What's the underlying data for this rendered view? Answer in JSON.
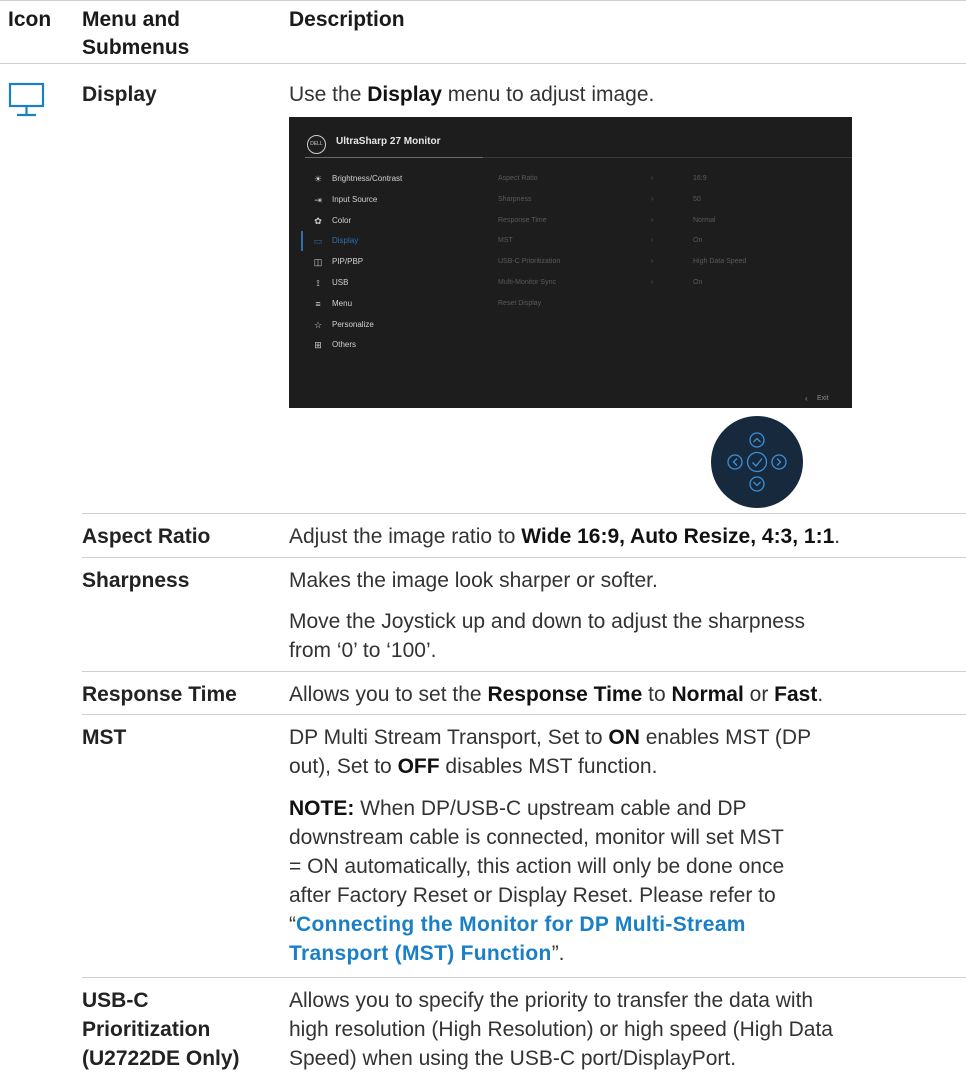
{
  "header": {
    "icon": "Icon",
    "menu": "Menu and Submenus",
    "description": "Description"
  },
  "display_row": {
    "icon": "monitor-icon",
    "label": "Display",
    "desc_pre": "Use the ",
    "desc_bold": "Display",
    "desc_post": " menu to adjust image."
  },
  "osd": {
    "logo": "DELL",
    "title": "UltraSharp 27 Monitor",
    "nav": [
      {
        "icon": "brightness-icon",
        "glyph": "☀",
        "label": "Brightness/Contrast"
      },
      {
        "icon": "input-source-icon",
        "glyph": "⇥",
        "label": "Input Source"
      },
      {
        "icon": "color-icon",
        "glyph": "✿",
        "label": "Color"
      },
      {
        "icon": "display-icon",
        "glyph": "▭",
        "label": "Display",
        "active": true
      },
      {
        "icon": "pip-pbp-icon",
        "glyph": "◫",
        "label": "PIP/PBP"
      },
      {
        "icon": "usb-icon",
        "glyph": "⟟",
        "label": "USB"
      },
      {
        "icon": "menu-icon",
        "glyph": "≡",
        "label": "Menu"
      },
      {
        "icon": "star-icon",
        "glyph": "☆",
        "label": "Personalize"
      },
      {
        "icon": "others-icon",
        "glyph": "⊞",
        "label": "Others"
      }
    ],
    "options": [
      {
        "label": "Aspect Ratio",
        "value": "16:9"
      },
      {
        "label": "Sharpness",
        "value": "50"
      },
      {
        "label": "Response Time",
        "value": "Normal"
      },
      {
        "label": "MST",
        "value": "On"
      },
      {
        "label": "USB-C Prioritization",
        "value": "High Data Speed"
      },
      {
        "label": "Multi-Monitor Sync",
        "value": "On"
      },
      {
        "label": "Reset Display",
        "value": ""
      }
    ],
    "exit": "Exit",
    "colors": {
      "active": "#2e6fb0",
      "background": "#1d1d1d"
    }
  },
  "joystick": {
    "icon": "joystick-icon",
    "color": "#172a3d",
    "accent": "#3d8fd6"
  },
  "rows": {
    "aspect": {
      "label": "Aspect Ratio",
      "pre": "Adjust the image ratio to ",
      "bold": "Wide 16:9, Auto Resize, 4:3, 1:1",
      "post": "."
    },
    "sharpness": {
      "label": "Sharpness",
      "p1": "Makes the image look sharper or softer.",
      "p2a": "Move the Joystick up and down to adjust the sharpness",
      "p2b": "from ‘0’ to ‘100’."
    },
    "response": {
      "label": "Response Time",
      "pre": "Allows you to set the ",
      "b1": "Response Time",
      "mid": " to ",
      "b2": "Normal",
      "or": " or ",
      "b3": "Fast",
      "post": "."
    },
    "mst": {
      "label": "MST",
      "l1": "DP Multi Stream Transport, Set to ",
      "on": "ON",
      "l1b": " enables MST (DP",
      "l2a": "out), Set to ",
      "off": "OFF",
      "l2b": " disables MST function.",
      "note_label": "NOTE:",
      "n1": " When DP/USB-C upstream cable and DP",
      "n2": "downstream cable is connected, monitor will set MST",
      "n3": "= ON automatically, this action will only be done once",
      "n4": "after Factory Reset or Display Reset. Please refer to",
      "q_open": "“",
      "link1": "Connecting the Monitor for DP Multi-Stream",
      "link2": "Transport (MST) Function",
      "q_close": "”."
    },
    "usbc": {
      "label1": "USB-C",
      "label2": "Prioritization",
      "label3": "(U2722DE Only)",
      "l1": "Allows you to specify the priority to transfer the data with",
      "l2": "high resolution (High Resolution) or high speed (High Data",
      "l3": "Speed) when using the USB-C port/DisplayPort."
    }
  },
  "colors": {
    "link": "#1a7fc6",
    "icon": "#1a7fc6",
    "rule": "#cfcfcf"
  }
}
